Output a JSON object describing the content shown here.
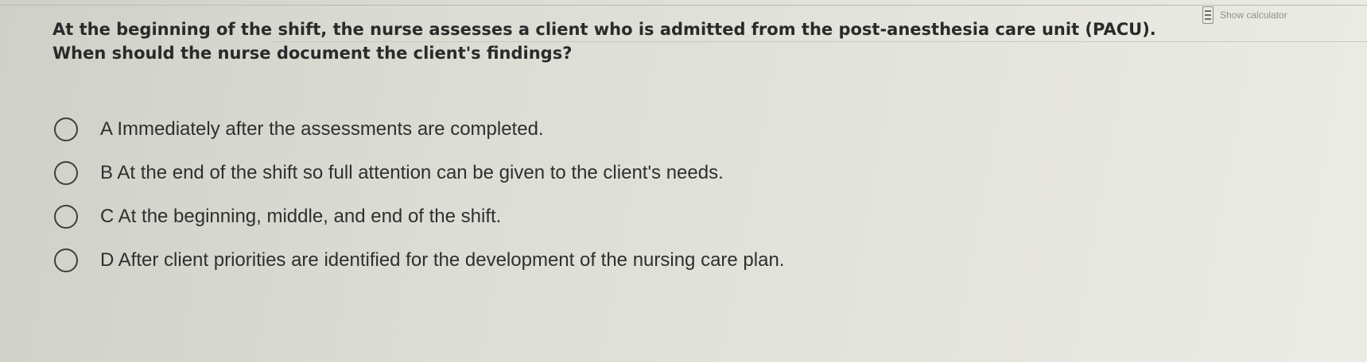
{
  "toolbar": {
    "calculator_label": "Show calculator",
    "calculator_icon": "calculator-icon"
  },
  "question": {
    "text": "At the beginning of the shift, the nurse assesses a client who is admitted from the post-anesthesia care unit (PACU). When should the nurse document the client's findings?"
  },
  "options": [
    {
      "label": "A Immediately after the assessments are completed."
    },
    {
      "label": "B At the end of the shift so full attention can be given to the client's needs."
    },
    {
      "label": "C At the beginning, middle, and end of the shift."
    },
    {
      "label": "D After client priorities are identified for the development of the nursing care plan."
    }
  ]
}
